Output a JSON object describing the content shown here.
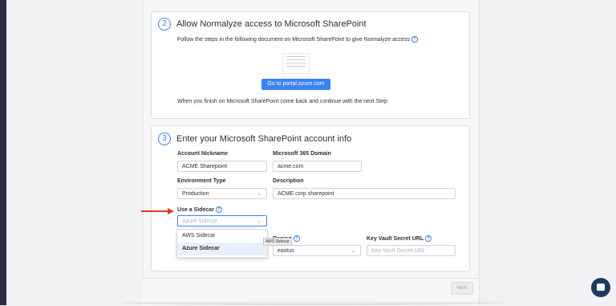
{
  "step2": {
    "number": "2",
    "title": "Allow Normalyze access to Microsoft SharePoint",
    "instructions": "Follow the steps in the following document on Microsoft SharePoint to give Normalyze access",
    "portal_button": "Go to portal.azure.com",
    "finish_note": "When you finish on Microsoft SharePoint come back and continue with the next Step"
  },
  "step3": {
    "number": "3",
    "title": "Enter your Microsoft SharePoint account info",
    "account_nickname": {
      "label": "Account Nickname",
      "value": "ACME Sharepoint"
    },
    "domain": {
      "label": "Microsoft 365 Domain",
      "value": "acme.com"
    },
    "environment_type": {
      "label": "Environment Type",
      "value": "Production"
    },
    "description": {
      "label": "Description",
      "value": "ACME corp sharepoint"
    },
    "sidecar": {
      "label": "Use a Sidecar",
      "placeholder": "Azure Sidecar"
    },
    "sidecar_options": [
      "AWS Sidecar",
      "Azure Sidecar"
    ],
    "sidecar_selected": "Azure Sidecar",
    "tooltip": "AWS Sidecar",
    "region": {
      "label": "Region",
      "value": "eastus"
    },
    "key_vault": {
      "label": "Key Vault Secret URL",
      "placeholder": "Key Vault Secret URL"
    }
  },
  "footer": {
    "next_label": "Next"
  },
  "colors": {
    "accent": "#3b82f6",
    "arrow": "#e03a1e"
  },
  "icons": [
    "info-icon",
    "chevron-down-icon",
    "chat-icon",
    "document-thumbnail",
    "arrow-annotation"
  ]
}
